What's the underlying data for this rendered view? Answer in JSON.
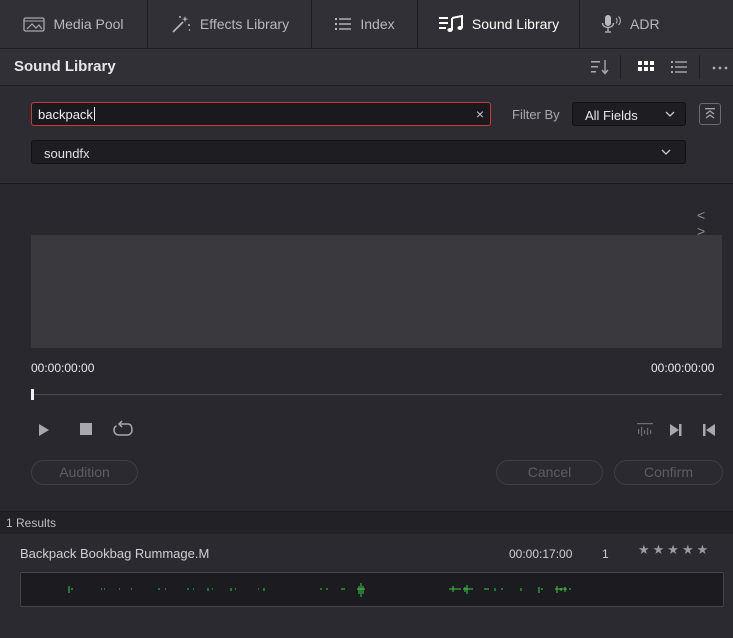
{
  "tabs": [
    {
      "label": "Media Pool",
      "icon": "media-pool-icon"
    },
    {
      "label": "Effects Library",
      "icon": "effects-wand-icon"
    },
    {
      "label": "Index",
      "icon": "index-list-icon"
    },
    {
      "label": "Sound Library",
      "icon": "sound-library-icon",
      "active": true
    },
    {
      "label": "ADR",
      "icon": "microphone-icon"
    }
  ],
  "header": {
    "title": "Sound Library",
    "icons": [
      "sort-icon",
      "grid-view-icon",
      "list-view-icon",
      "more-options-icon"
    ]
  },
  "search": {
    "value": "backpack",
    "clear_glyph": "×",
    "filter_label": "Filter By",
    "filter_value": "All Fields",
    "library_value": "soundfx"
  },
  "preview": {
    "nav_glyphs": "< >",
    "timecode_start": "00:00:00:00",
    "timecode_end": "00:00:00:00",
    "playhead_progress": 0,
    "audition_label": "Audition",
    "cancel_label": "Cancel",
    "confirm_label": "Confirm"
  },
  "results": {
    "count_label": "1 Results",
    "items": [
      {
        "name": "Backpack Bookbag Rummage.M",
        "duration": "00:00:17:00",
        "count": "1",
        "stars": "★★★★★",
        "waveform_color": "#3cc84a"
      }
    ]
  },
  "colors": {
    "accent_search_border": "#c83a3a",
    "waveform": "#3cc84a",
    "background": "#28282e"
  }
}
